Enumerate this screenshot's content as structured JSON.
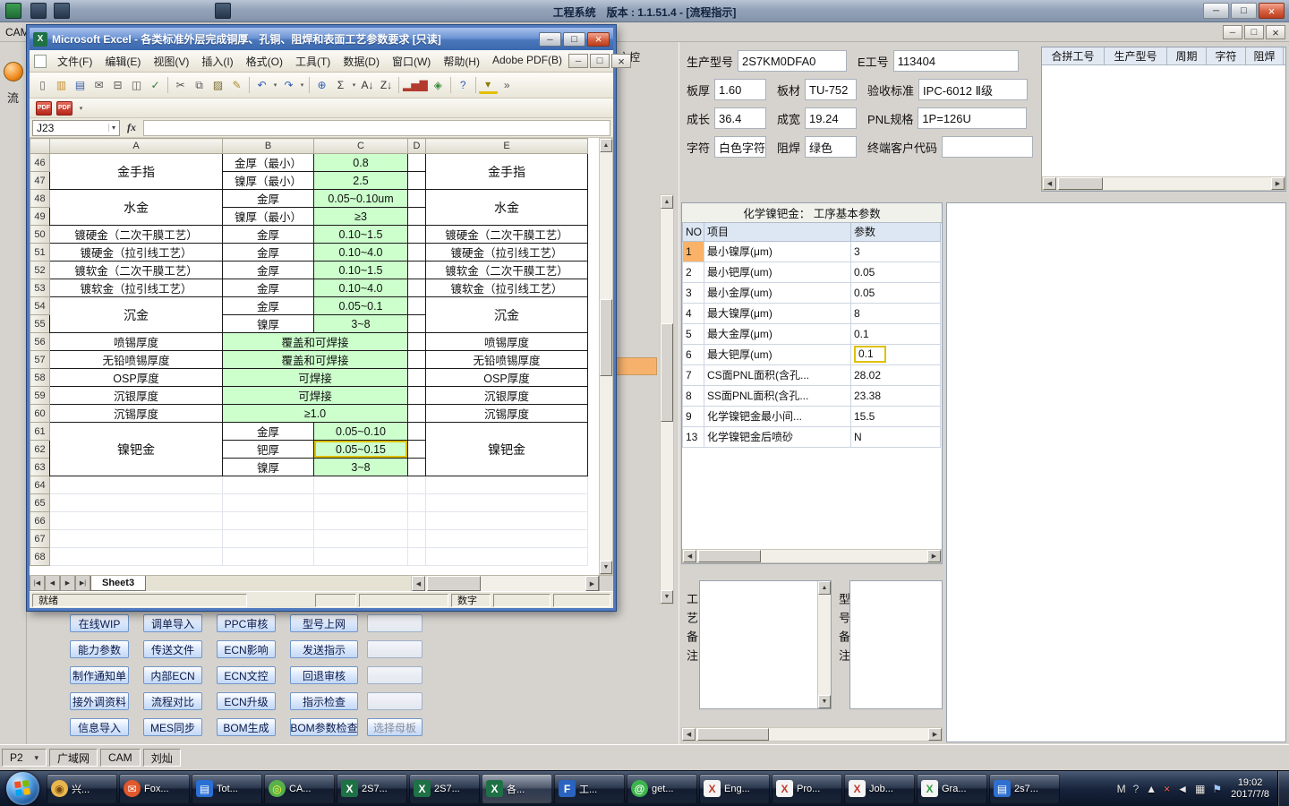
{
  "colors": {
    "cell_green": "#ccffcc",
    "annotation_yellow": "#dfc100",
    "selected_no_orange": "#f9b268",
    "excel_title_blue": "#4a76ba",
    "taskbar_dark": "#16223a",
    "action_button_face": "#c3d8f6"
  },
  "main_window": {
    "title": "工程系统　版本 : 1.1.51.4 - [流程指示]",
    "menu_left": "CAM",
    "side_tab_char": "流",
    "strip_top_label": "文控",
    "status": {
      "page_selector": "P2",
      "items": [
        "广域网",
        "CAM",
        "刘灿"
      ]
    }
  },
  "info_panel": {
    "rows": [
      [
        {
          "label": "生产型号",
          "value": "2S7KM0DFA0",
          "size": "lg"
        },
        {
          "label": "E工号",
          "value": "113404",
          "size": "xl"
        }
      ],
      [
        {
          "label": "板厚",
          "value": "1.60",
          "size": "sm"
        },
        {
          "label": "板材",
          "value": "TU-752",
          "size": "sm"
        },
        {
          "label": "验收标准",
          "value": "IPC-6012 Ⅱ级",
          "size": "lg2"
        }
      ],
      [
        {
          "label": "成长",
          "value": "36.4",
          "size": "sm"
        },
        {
          "label": "成宽",
          "value": "19.24",
          "size": "sm"
        },
        {
          "label": "PNL规格",
          "value": "1P=126U",
          "size": "lg2"
        }
      ],
      [
        {
          "label": "字符",
          "value": "白色字符",
          "size": "sm"
        },
        {
          "label": "阻焊",
          "value": "绿色",
          "size": "sm"
        },
        {
          "label": "终端客户代码",
          "value": "",
          "size": "lg3"
        }
      ]
    ]
  },
  "pair_grid": {
    "headers": [
      "合拼工号",
      "生产型号",
      "周期",
      "字符",
      "阻焊"
    ]
  },
  "param_panel": {
    "title": "化学镍钯金： 工序基本参数",
    "headers": [
      "NO",
      "项目",
      "参数"
    ],
    "rows": [
      {
        "no": "1",
        "item": "最小镍厚(μm)",
        "value": "3",
        "selected": true
      },
      {
        "no": "2",
        "item": "最小钯厚(um)",
        "value": "0.05"
      },
      {
        "no": "3",
        "item": "最小金厚(um)",
        "value": "0.05"
      },
      {
        "no": "4",
        "item": "最大镍厚(μm)",
        "value": "8"
      },
      {
        "no": "5",
        "item": "最大金厚(μm)",
        "value": "0.1"
      },
      {
        "no": "6",
        "item": "最大钯厚(um)",
        "value": "0.1",
        "highlight": true
      },
      {
        "no": "7",
        "item": "CS面PNL面积(含孔...",
        "value": "28.02"
      },
      {
        "no": "8",
        "item": "SS面PNL面积(含孔...",
        "value": "23.38"
      },
      {
        "no": "9",
        "item": "化学镍钯金最小间...",
        "value": "15.5"
      },
      {
        "no": "13",
        "item": "化学镍钯金后喷砂",
        "value": "N"
      }
    ]
  },
  "notes": {
    "left_label": "工艺备注",
    "right_label": "型号备注"
  },
  "action_buttons": {
    "rows": [
      [
        "在线WIP",
        "调单导入",
        "PPC审核",
        "型号上网",
        ""
      ],
      [
        "能力参数",
        "传送文件",
        "ECN影响",
        "发送指示",
        ""
      ],
      [
        "制作通知单",
        "内部ECN",
        "ECN文控",
        "回退审核",
        ""
      ],
      [
        "接外调资料",
        "流程对比",
        "ECN升级",
        "指示检查",
        ""
      ],
      [
        "信息导入",
        "MES同步",
        "BOM生成",
        "BOM参数检查",
        "选择母板"
      ]
    ]
  },
  "excel": {
    "title": "Microsoft Excel - 各类标准外层完成铜厚、孔铜、阻焊和表面工艺参数要求  [只读]",
    "menus": [
      "文件(F)",
      "编辑(E)",
      "视图(V)",
      "插入(I)",
      "格式(O)",
      "工具(T)",
      "数据(D)",
      "窗口(W)",
      "帮助(H)",
      "Adobe PDF(B)"
    ],
    "toolbar": [
      {
        "name": "new-icon",
        "glyph": "▯",
        "color": "#666"
      },
      {
        "name": "open-icon",
        "glyph": "▥",
        "color": "#c78f2d"
      },
      {
        "name": "save-icon",
        "glyph": "▤",
        "color": "#3d5fae"
      },
      {
        "name": "mail-icon",
        "glyph": "✉",
        "color": "#555"
      },
      {
        "name": "print-icon",
        "glyph": "⊟",
        "color": "#555"
      },
      {
        "name": "print-preview-icon",
        "glyph": "◫",
        "color": "#555"
      },
      {
        "name": "spelling-icon",
        "glyph": "✓",
        "color": "#2e7d32"
      },
      {
        "sep": true
      },
      {
        "name": "cut-icon",
        "glyph": "✂",
        "color": "#555"
      },
      {
        "name": "copy-icon",
        "glyph": "⧉",
        "color": "#555"
      },
      {
        "name": "paste-icon",
        "glyph": "▨",
        "color": "#7a6a2a"
      },
      {
        "name": "format-painter-icon",
        "glyph": "✎",
        "color": "#b08f2a"
      },
      {
        "sep": true
      },
      {
        "name": "undo-icon",
        "glyph": "↶",
        "color": "#2f5fb8",
        "drop": true
      },
      {
        "name": "redo-icon",
        "glyph": "↷",
        "color": "#2f5fb8",
        "drop": true
      },
      {
        "sep": true
      },
      {
        "name": "hyperlink-icon",
        "glyph": "⊕",
        "color": "#2f5fb8"
      },
      {
        "name": "autosum-icon",
        "glyph": "Σ",
        "color": "#333",
        "drop": true
      },
      {
        "name": "sort-ascending-icon",
        "glyph": "A↓",
        "color": "#333"
      },
      {
        "name": "sort-descending-icon",
        "glyph": "Z↓",
        "color": "#333"
      },
      {
        "sep": true
      },
      {
        "name": "chart-wizard-icon",
        "glyph": "▂▅▇",
        "color": "#b23b2e"
      },
      {
        "name": "drawing-icon",
        "glyph": "◈",
        "color": "#3d8b3d"
      },
      {
        "sep": true
      },
      {
        "name": "help-icon",
        "glyph": "?",
        "color": "#2f5fb8"
      },
      {
        "sep": true
      },
      {
        "name": "fill-color-icon",
        "glyph": "▾",
        "color": "#8a7a00"
      },
      {
        "name": "toolbar-options-icon",
        "glyph": "»",
        "color": "#555"
      }
    ],
    "pdf_labels": [
      "PDF",
      "PDF"
    ],
    "name_box": "J23",
    "fx_label": "fx",
    "columns": [
      "A",
      "B",
      "C",
      "D",
      "E"
    ],
    "nav": [
      "|◀",
      "◀",
      "▶",
      "▶|"
    ],
    "sheet_tab": "Sheet3",
    "status_ready": "就绪",
    "status_num": "数字",
    "grid_rows": [
      {
        "n": 46,
        "cells": [
          {
            "col": "A",
            "text": "金手指",
            "rowspan": 2,
            "cls": "name"
          },
          {
            "col": "B",
            "text": "金厚（最小）"
          },
          {
            "col": "C",
            "text": "0.8",
            "green": true
          },
          {
            "col": "D",
            "text": ""
          },
          {
            "col": "E",
            "text": "金手指",
            "rowspan": 2,
            "cls": "name"
          }
        ]
      },
      {
        "n": 47,
        "cells": [
          {
            "col": "B",
            "text": "镍厚（最小）"
          },
          {
            "col": "C",
            "text": "2.5",
            "green": true
          },
          {
            "col": "D",
            "text": ""
          }
        ]
      },
      {
        "n": 48,
        "cells": [
          {
            "col": "A",
            "text": "水金",
            "rowspan": 2,
            "cls": "name"
          },
          {
            "col": "B",
            "text": "金厚"
          },
          {
            "col": "C",
            "text": "0.05~0.10um",
            "green": true
          },
          {
            "col": "D",
            "text": ""
          },
          {
            "col": "E",
            "text": "水金",
            "rowspan": 2,
            "cls": "name"
          }
        ]
      },
      {
        "n": 49,
        "cells": [
          {
            "col": "B",
            "text": "镍厚（最小）"
          },
          {
            "col": "C",
            "text": "≥3",
            "green": true
          },
          {
            "col": "D",
            "text": ""
          }
        ]
      },
      {
        "n": 50,
        "cells": [
          {
            "col": "A",
            "text": "镀硬金（二次干膜工艺）"
          },
          {
            "col": "B",
            "text": "金厚"
          },
          {
            "col": "C",
            "text": "0.10~1.5",
            "green": true
          },
          {
            "col": "D",
            "text": ""
          },
          {
            "col": "E",
            "text": "镀硬金（二次干膜工艺）"
          }
        ]
      },
      {
        "n": 51,
        "cells": [
          {
            "col": "A",
            "text": "镀硬金（拉引线工艺）"
          },
          {
            "col": "B",
            "text": "金厚"
          },
          {
            "col": "C",
            "text": "0.10~4.0",
            "green": true
          },
          {
            "col": "D",
            "text": ""
          },
          {
            "col": "E",
            "text": "镀硬金（拉引线工艺）"
          }
        ]
      },
      {
        "n": 52,
        "cells": [
          {
            "col": "A",
            "text": "镀软金（二次干膜工艺）"
          },
          {
            "col": "B",
            "text": "金厚"
          },
          {
            "col": "C",
            "text": "0.10~1.5",
            "green": true
          },
          {
            "col": "D",
            "text": ""
          },
          {
            "col": "E",
            "text": "镀软金（二次干膜工艺）"
          }
        ]
      },
      {
        "n": 53,
        "cells": [
          {
            "col": "A",
            "text": "镀软金（拉引线工艺）"
          },
          {
            "col": "B",
            "text": "金厚"
          },
          {
            "col": "C",
            "text": "0.10~4.0",
            "green": true
          },
          {
            "col": "D",
            "text": ""
          },
          {
            "col": "E",
            "text": "镀软金（拉引线工艺）"
          }
        ]
      },
      {
        "n": 54,
        "cells": [
          {
            "col": "A",
            "text": "沉金",
            "rowspan": 2,
            "cls": "name"
          },
          {
            "col": "B",
            "text": "金厚"
          },
          {
            "col": "C",
            "text": "0.05~0.1",
            "green": true
          },
          {
            "col": "D",
            "text": ""
          },
          {
            "col": "E",
            "text": "沉金",
            "rowspan": 2,
            "cls": "name"
          }
        ]
      },
      {
        "n": 55,
        "cells": [
          {
            "col": "B",
            "text": "镍厚"
          },
          {
            "col": "C",
            "text": "3~8",
            "green": true
          },
          {
            "col": "D",
            "text": ""
          }
        ]
      },
      {
        "n": 56,
        "cells": [
          {
            "col": "A",
            "text": "喷锡厚度"
          },
          {
            "col": "B",
            "text": "覆盖和可焊接",
            "colspan": 2,
            "green": true
          },
          {
            "col": "D",
            "text": ""
          },
          {
            "col": "E",
            "text": "喷锡厚度"
          }
        ]
      },
      {
        "n": 57,
        "cells": [
          {
            "col": "A",
            "text": "无铅喷锡厚度"
          },
          {
            "col": "B",
            "text": "覆盖和可焊接",
            "colspan": 2,
            "green": true
          },
          {
            "col": "D",
            "text": ""
          },
          {
            "col": "E",
            "text": "无铅喷锡厚度"
          }
        ]
      },
      {
        "n": 58,
        "cells": [
          {
            "col": "A",
            "text": "OSP厚度"
          },
          {
            "col": "B",
            "text": "可焊接",
            "colspan": 2,
            "green": true
          },
          {
            "col": "D",
            "text": ""
          },
          {
            "col": "E",
            "text": "OSP厚度"
          }
        ]
      },
      {
        "n": 59,
        "cells": [
          {
            "col": "A",
            "text": "沉银厚度"
          },
          {
            "col": "B",
            "text": "可焊接",
            "colspan": 2,
            "green": true
          },
          {
            "col": "D",
            "text": ""
          },
          {
            "col": "E",
            "text": "沉银厚度"
          }
        ]
      },
      {
        "n": 60,
        "cells": [
          {
            "col": "A",
            "text": "沉锡厚度"
          },
          {
            "col": "B",
            "text": "≥1.0",
            "colspan": 2,
            "green": true
          },
          {
            "col": "D",
            "text": ""
          },
          {
            "col": "E",
            "text": "沉锡厚度"
          }
        ]
      },
      {
        "n": 61,
        "cells": [
          {
            "col": "A",
            "text": "镍钯金",
            "rowspan": 3,
            "cls": "name"
          },
          {
            "col": "B",
            "text": "金厚"
          },
          {
            "col": "C",
            "text": "0.05~0.10",
            "green": true
          },
          {
            "col": "D",
            "text": ""
          },
          {
            "col": "E",
            "text": "镍钯金",
            "rowspan": 3,
            "cls": "name"
          }
        ]
      },
      {
        "n": 62,
        "cells": [
          {
            "col": "B",
            "text": "钯厚"
          },
          {
            "col": "C",
            "text": "0.05~0.15",
            "green": true,
            "annot": true
          },
          {
            "col": "D",
            "text": ""
          }
        ]
      },
      {
        "n": 63,
        "cells": [
          {
            "col": "B",
            "text": "镍厚"
          },
          {
            "col": "C",
            "text": "3~8",
            "green": true
          },
          {
            "col": "D",
            "text": ""
          }
        ]
      },
      {
        "n": 64,
        "cells": []
      },
      {
        "n": 65,
        "cells": []
      },
      {
        "n": 66,
        "cells": []
      },
      {
        "n": 67,
        "cells": []
      },
      {
        "n": 68,
        "cells": []
      }
    ]
  },
  "taskbar": {
    "items": [
      {
        "label": "兴...",
        "glyph": "◉",
        "bg": "#e8b64c",
        "fg": "#7a4c12",
        "shape": "circle",
        "icon_name": "shell-icon"
      },
      {
        "label": "Fox...",
        "glyph": "✉",
        "bg": "#e1582c",
        "fg": "#ffffff",
        "shape": "circle",
        "icon_name": "foxmail-icon"
      },
      {
        "label": "Tot...",
        "glyph": "▤",
        "bg": "#2a6fd4",
        "fg": "#ffffff",
        "shape": "square",
        "icon_name": "total-commander-icon"
      },
      {
        "label": "CA...",
        "glyph": "◎",
        "bg": "#58b14c",
        "fg": "#fff73d",
        "shape": "circle",
        "icon_name": "cam-tool-icon"
      },
      {
        "label": "2S7...",
        "glyph": "X",
        "bg": "#1e7145",
        "fg": "#ffffff",
        "shape": "square",
        "icon_name": "excel-file-icon"
      },
      {
        "label": "2S7...",
        "glyph": "X",
        "bg": "#1e7145",
        "fg": "#ffffff",
        "shape": "square",
        "icon_name": "excel-file-icon"
      },
      {
        "label": "各...",
        "glyph": "X",
        "bg": "#1e7145",
        "fg": "#ffffff",
        "shape": "square",
        "active": true,
        "icon_name": "excel-file-icon"
      },
      {
        "label": "工...",
        "glyph": "F",
        "bg": "#2a63c0",
        "fg": "#ffffff",
        "shape": "square",
        "icon_name": "engineering-app-icon"
      },
      {
        "label": "get...",
        "glyph": "@",
        "bg": "#3cb44b",
        "fg": "#ffffff",
        "shape": "circle",
        "icon_name": "getter-app-icon"
      },
      {
        "label": "Eng...",
        "glyph": "X",
        "bg": "#f4f4f4",
        "fg": "#c23b2e",
        "shape": "square",
        "icon_name": "excel-doc-icon"
      },
      {
        "label": "Pro...",
        "glyph": "X",
        "bg": "#f4f4f4",
        "fg": "#c23b2e",
        "shape": "square",
        "icon_name": "excel-doc-icon"
      },
      {
        "label": "Job...",
        "glyph": "X",
        "bg": "#f4f4f4",
        "fg": "#c23b2e",
        "shape": "square",
        "icon_name": "excel-doc-icon"
      },
      {
        "label": "Gra...",
        "glyph": "X",
        "bg": "#f4f4f4",
        "fg": "#2e9e44",
        "shape": "square",
        "icon_name": "excel-doc-icon"
      },
      {
        "label": "2s7...",
        "glyph": "▤",
        "bg": "#2f6fd0",
        "fg": "#ffffff",
        "shape": "square",
        "icon_name": "document-icon"
      }
    ],
    "tray": [
      {
        "name": "ime-indicator",
        "glyph": "M",
        "color": "#e8e8e8"
      },
      {
        "name": "help-tray-icon",
        "glyph": "?",
        "color": "#bcd6f0"
      },
      {
        "name": "show-hidden-icons-button",
        "glyph": "▲",
        "color": "#e8e8e8"
      },
      {
        "name": "alert-tray-icon",
        "glyph": "×",
        "color": "#ff6a5a"
      },
      {
        "name": "volume-tray-icon",
        "glyph": "◄",
        "color": "#e8e8e8"
      },
      {
        "name": "network-tray-icon",
        "glyph": "▦",
        "color": "#e8e8e8"
      },
      {
        "name": "action-center-icon",
        "glyph": "⚑",
        "color": "#9fc6ff"
      }
    ]
  },
  "clock": {
    "time": "19:02",
    "date": "2017/7/8"
  }
}
